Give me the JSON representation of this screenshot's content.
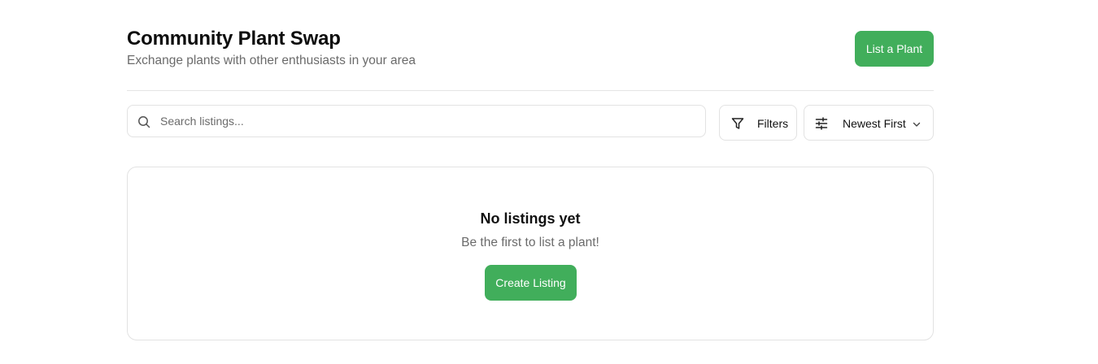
{
  "header": {
    "title": "Community Plant Swap",
    "subtitle": "Exchange plants with other enthusiasts in your area",
    "list_button_label": "List a Plant"
  },
  "toolbar": {
    "search": {
      "placeholder": "Search listings...",
      "value": ""
    },
    "filters_label": "Filters",
    "sort": {
      "selected": "Newest First"
    }
  },
  "empty_state": {
    "title": "No listings yet",
    "description": "Be the first to list a plant!",
    "button_label": "Create Listing"
  },
  "icons": {
    "search": "search-icon",
    "filter": "filter-icon",
    "sort": "sliders-icon",
    "dropdown": "chevron-down-icon"
  },
  "colors": {
    "accent": "#41ae5b",
    "text_primary": "#111111",
    "text_muted": "#6b6b6b",
    "border": "#e2e2e2"
  }
}
